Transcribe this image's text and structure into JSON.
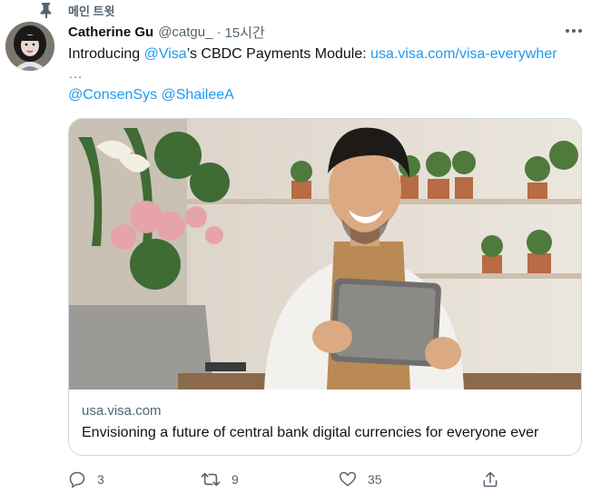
{
  "pinned": {
    "label": "메인 트윗"
  },
  "tweet": {
    "author_name": "Catherine Gu",
    "author_handle": "@catgu_",
    "separator": "·",
    "time": "15시간",
    "text_intro": "Introducing ",
    "text_mention": "@Visa",
    "text_middle": "’s CBDC Payments Module: ",
    "text_link": "usa.visa.com/visa-everywher",
    "text_ellipsis": "…",
    "mention_1": "@ConsenSys",
    "mention_2": "@ShaileeA"
  },
  "card": {
    "domain": "usa.visa.com",
    "title": "Envisioning a future of central bank digital currencies for everyone ever"
  },
  "actions": {
    "reply_count": "3",
    "retweet_count": "9",
    "like_count": "35"
  },
  "icons": {
    "pin": "pin-icon",
    "more": "more-icon",
    "reply": "reply-icon",
    "retweet": "retweet-icon",
    "like": "heart-icon",
    "share": "share-icon"
  },
  "colors": {
    "link": "#1d9bf0",
    "secondary_text": "#536471",
    "border": "#cfd9de"
  }
}
